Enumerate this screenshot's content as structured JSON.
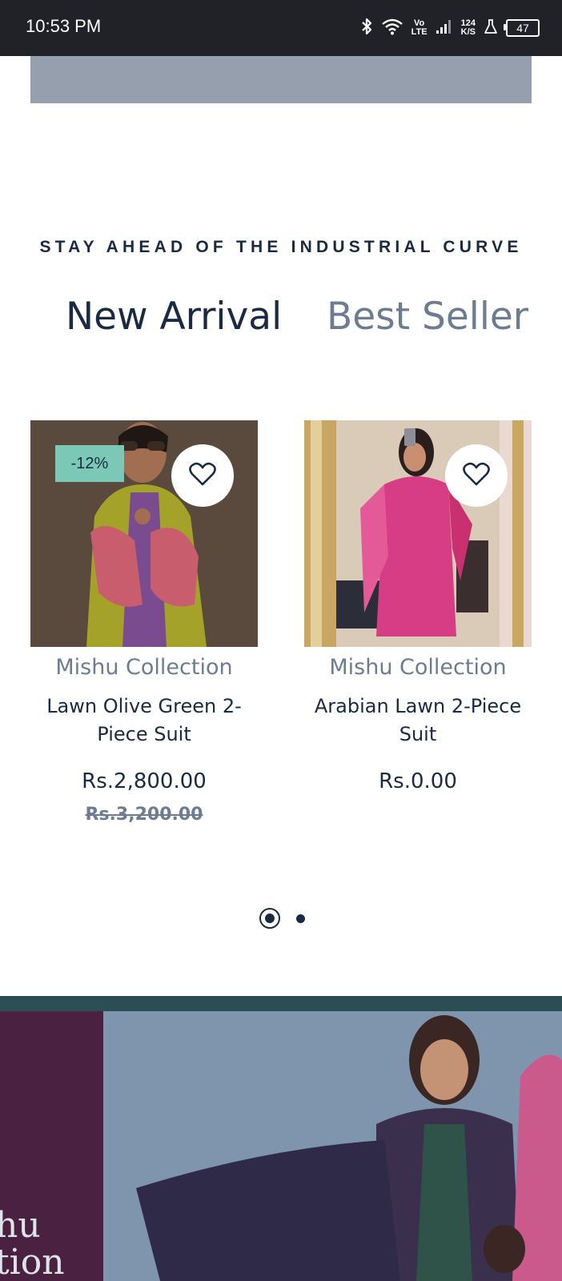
{
  "status_bar": {
    "time": "10:53 PM",
    "network_label_top": "Vo",
    "network_label_bottom": "LTE",
    "speed_value": "124",
    "speed_unit": "K/S",
    "battery": "47"
  },
  "section": {
    "eyebrow": "STAY AHEAD OF THE INDUSTRIAL CURVE",
    "tabs": [
      {
        "label": "New Arrival",
        "active": true
      },
      {
        "label": "Best Seller",
        "active": false
      }
    ]
  },
  "products": [
    {
      "badge": "-12%",
      "vendor": "Mishu Collection",
      "title": "Lawn Olive Green 2-Piece Suit",
      "price": "Rs.2,800.00",
      "compare_price": "Rs.3,200.00"
    },
    {
      "vendor": "Mishu Collection",
      "title": "Arabian Lawn 2-Piece Suit",
      "price": "Rs.0.00"
    }
  ],
  "pagination": {
    "total": 2,
    "active_index": 0
  },
  "promo": {
    "brand_line1": "hu",
    "brand_line2": "tion"
  },
  "colors": {
    "text_dark": "#1b2a43",
    "text_muted": "#6e7c91",
    "badge_bg": "#7ac8b5",
    "status_bar_bg": "#202227"
  }
}
